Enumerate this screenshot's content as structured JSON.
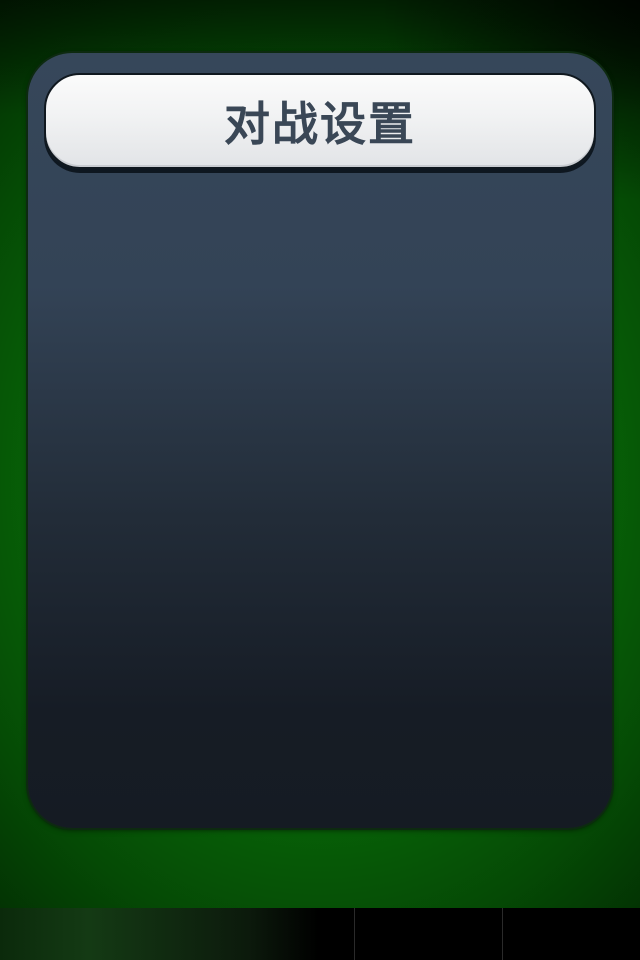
{
  "screen": {
    "title": "对战设置"
  },
  "colors": {
    "background_green": "#086a08",
    "panel_top": "#36475a",
    "panel_bottom": "#151b23",
    "title_text": "#3a4756",
    "title_bar": "#f1f2f3"
  }
}
